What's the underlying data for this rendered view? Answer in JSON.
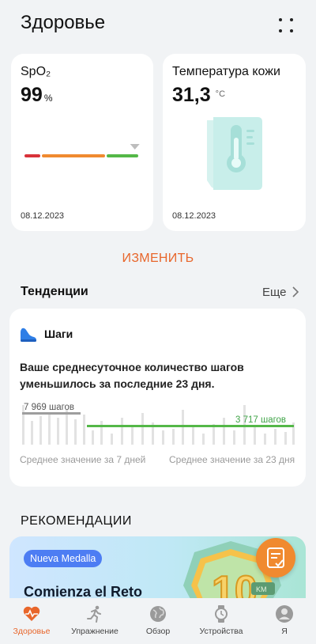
{
  "header": {
    "title": "Здоровье",
    "more_icon": "more-dots-icon"
  },
  "cards": {
    "spo2": {
      "label": "SpO₂",
      "value": "99",
      "unit": "%",
      "date": "08.12.2023",
      "level_fraction": 0.97,
      "colors": [
        "#d8323a",
        "#f08a2f",
        "#54b848"
      ]
    },
    "skin_temp": {
      "label": "Температура кожи",
      "value": "31,3",
      "unit": "°C",
      "date": "08.12.2023",
      "icon": "thermometer-icon"
    }
  },
  "edit_label": "ИЗМЕНИТЬ",
  "trends": {
    "title": "Тенденции",
    "more_label": "Еще",
    "steps": {
      "name": "Шаги",
      "icon": "shoe-icon",
      "description": "Ваше среднесуточное количество шагов уменьшилось за последние 23 дня.",
      "avg7_label": "7 969 шагов",
      "avg23_label": "3 717 шагов",
      "avg7_caption": "Среднее значение за 7 дней",
      "avg23_caption": "Среднее значение за 23 дня",
      "colors": {
        "avg7": "#9e9e9e",
        "avg23": "#54b848",
        "bars": "#e2e2e2"
      }
    }
  },
  "recommendations": {
    "title": "РЕКОМЕНДАЦИИ",
    "badge": "Nueva Medalla",
    "banner_title": "Comienza el Reto",
    "medal_text": "10",
    "medal_sub": "KM"
  },
  "tabs": [
    {
      "label": "Здоровье",
      "icon": "heart-pulse-icon",
      "active": true
    },
    {
      "label": "Упражнение",
      "icon": "runner-icon",
      "active": false
    },
    {
      "label": "Обзор",
      "icon": "globe-icon",
      "active": false
    },
    {
      "label": "Устройства",
      "icon": "watch-icon",
      "active": false
    },
    {
      "label": "Я",
      "icon": "profile-icon",
      "active": false
    }
  ],
  "accent": "#e8662b"
}
